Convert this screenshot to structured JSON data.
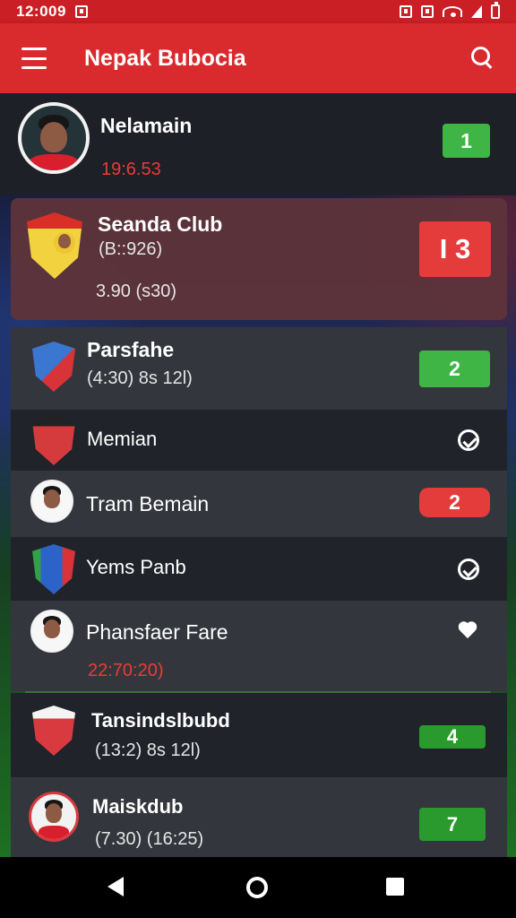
{
  "status_bar": {
    "time": "12:009"
  },
  "app_bar": {
    "title": "Nepak Bubocia"
  },
  "items": [
    {
      "name": "Nelamain",
      "subtitle": "19:6.53",
      "badge": "1",
      "badge_color": "#3fb546"
    },
    {
      "name": "Seanda Club",
      "subtitle": "(B::926)",
      "extra": "3.90 (s30)",
      "badge": "I 3",
      "badge_color": "#e43b3b"
    },
    {
      "name": "Parsfahe",
      "subtitle": "(4:30) 8s 12l)",
      "badge": "2",
      "badge_color": "#3fb546"
    },
    {
      "name": "Memian",
      "icon": "check-circle-icon"
    },
    {
      "name": "Tram Bemain",
      "badge": "2",
      "badge_color": "#e43b3b"
    },
    {
      "name": "Yems Panb",
      "icon": "check-circle-icon"
    },
    {
      "name": "Phansfaer Fare",
      "subtitle": "22:70:20)",
      "icon": "heart-icon"
    },
    {
      "name": "Tansindslbubd",
      "subtitle": "(13:2) 8s 12l)",
      "badge": "4",
      "badge_color": "#2a9a2f"
    },
    {
      "name": "Maiskdub",
      "subtitle": "(7.30) (16:25)",
      "badge": "7",
      "badge_color": "#2a9a2f"
    }
  ]
}
